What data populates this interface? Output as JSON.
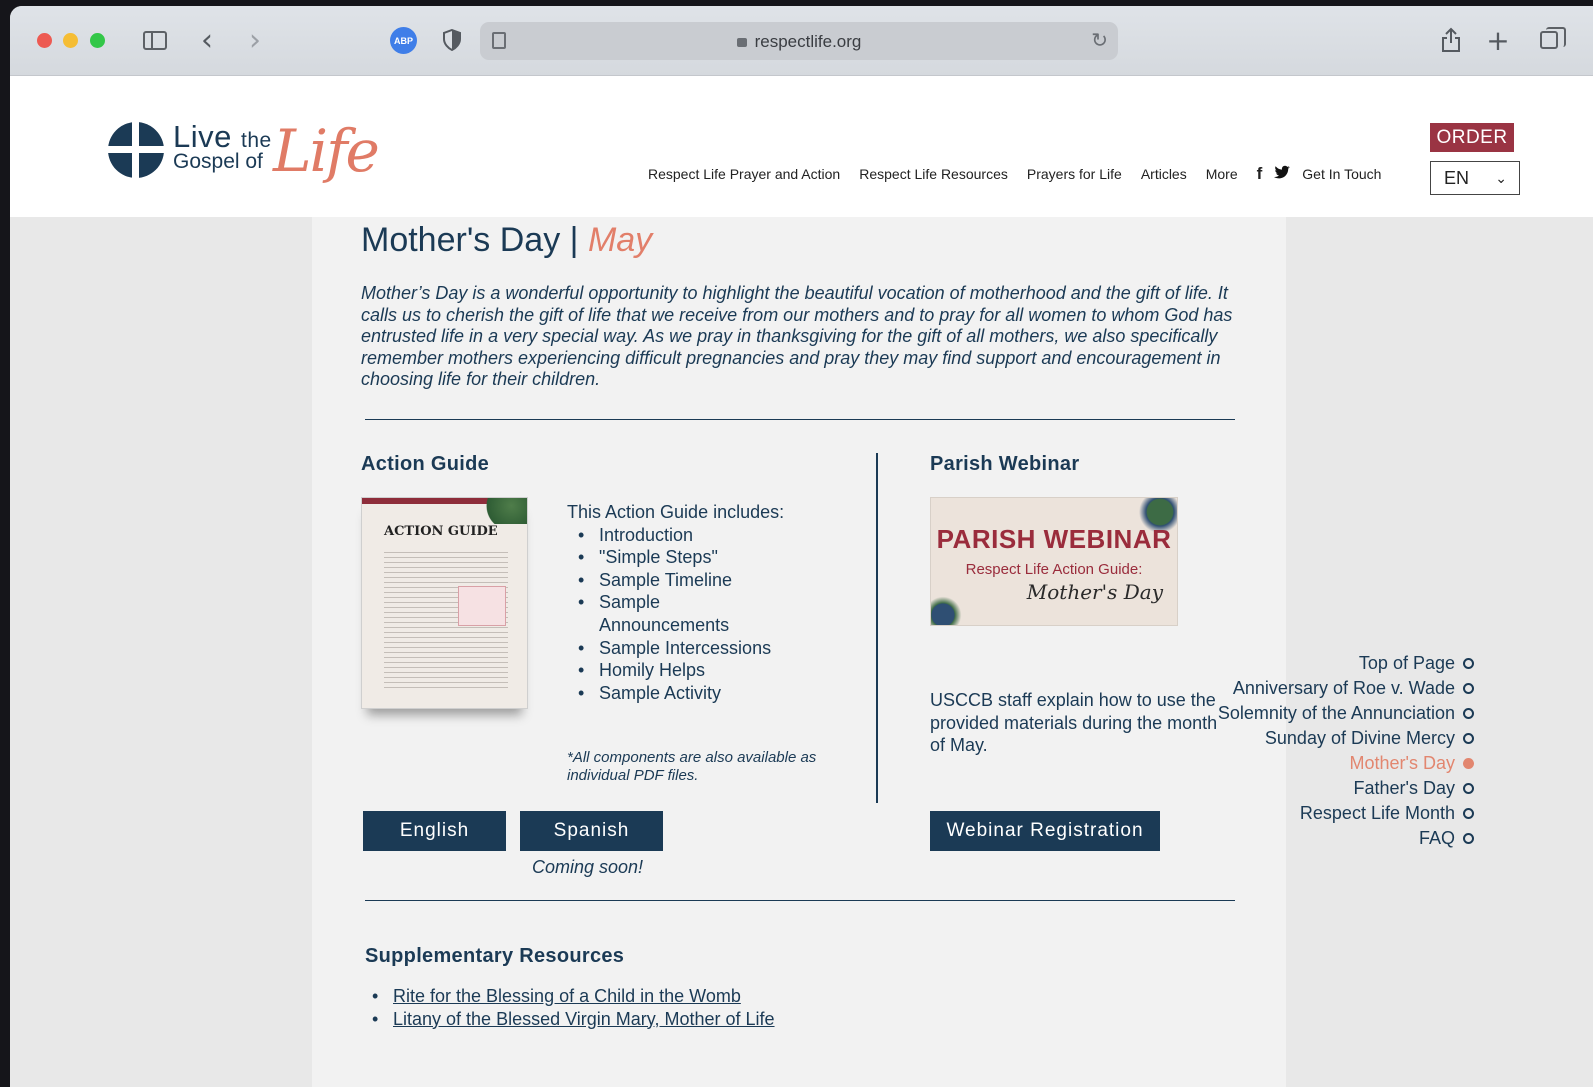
{
  "browser": {
    "url": "respectlife.org",
    "abp_label": "ABP"
  },
  "header": {
    "logo": {
      "line1": "Live",
      "line1_small": "the",
      "line2": "Gospel of",
      "script": "Life"
    },
    "nav": [
      "Respect Life Prayer and Action",
      "Respect Life Resources",
      "Prayers for Life",
      "Articles",
      "More"
    ],
    "social_facebook": "f",
    "social_twitter": "🐦",
    "contact": "Get In Touch",
    "order_label": "ORDER",
    "language": "EN"
  },
  "page": {
    "title": "Mother's Day |",
    "title_accent": "May",
    "intro": "Mother’s Day is a wonderful opportunity to highlight the beautiful vocation of motherhood and the gift of life. It calls us to cherish the gift of life that we receive from our mothers and to pray for all women to whom God has entrusted life in a very special way. As we pray in thanksgiving for the gift of all mothers, we also specifically remember mothers experiencing difficult pregnancies and pray they may find support and encouragement in choosing life for their children."
  },
  "action_guide": {
    "title": "Action Guide",
    "image_title": "ACTION GUIDE",
    "includes_heading": "This Action Guide includes:",
    "items": [
      "Introduction",
      "\"Simple Steps\"",
      "Sample Timeline",
      "Sample Announcements",
      "Sample Intercessions",
      "Homily Helps",
      "Sample Activity"
    ],
    "note": "*All components are also available as individual PDF files.",
    "english_label": "English",
    "spanish_label": "Spanish",
    "coming_soon": "Coming soon!"
  },
  "webinar": {
    "title": "Parish Webinar",
    "image_line1": "PARISH WEBINAR",
    "image_line2": "Respect Life Action Guide:",
    "image_line3": "Mother's Day",
    "description": "USCCB staff explain how to use the provided materials during the month of May.",
    "button_label": "Webinar Registration"
  },
  "supplementary": {
    "title": "Supplementary Resources",
    "links": [
      "Rite for the Blessing of a Child in the Womb",
      "Litany of the Blessed Virgin Mary, Mother of Life"
    ]
  },
  "page_nav": {
    "items": [
      "Top of Page",
      "Anniversary of Roe v. Wade",
      "Solemnity of the Annunciation",
      "Sunday of Divine Mercy",
      "Mother's Day",
      "Father's Day",
      "Respect Life Month",
      "FAQ"
    ],
    "active": "Mother's Day"
  },
  "colors": {
    "navy": "#1b3a55",
    "accent": "#e27f6a",
    "order": "#9a3443"
  }
}
